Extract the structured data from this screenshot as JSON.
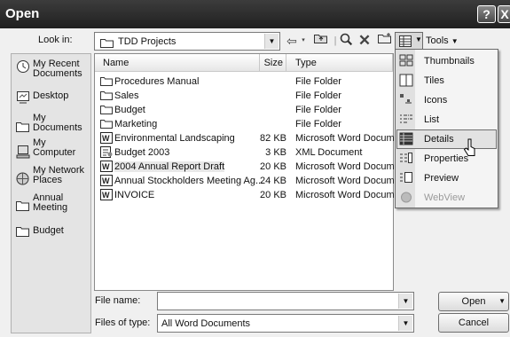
{
  "window": {
    "title": "Open",
    "help_button": "?",
    "close_button": "X"
  },
  "lookin": {
    "label": "Look in:",
    "value": "TDD Projects"
  },
  "toolbar": {
    "tools_label": "Tools"
  },
  "places": [
    {
      "label": "My Recent Documents",
      "icon": "recent-documents-icon"
    },
    {
      "label": "Desktop",
      "icon": "desktop-icon"
    },
    {
      "label": "My Documents",
      "icon": "my-documents-icon"
    },
    {
      "label": "My Computer",
      "icon": "computer-icon"
    },
    {
      "label": "My Network Places",
      "icon": "network-icon"
    },
    {
      "label": "Annual Meeting",
      "icon": "folder-icon"
    },
    {
      "label": "Budget",
      "icon": "folder-icon"
    }
  ],
  "columns": {
    "name": "Name",
    "size": "Size",
    "type": "Type"
  },
  "files": [
    {
      "name": "Procedures Manual",
      "size": "",
      "type": "File Folder",
      "icon": "folder"
    },
    {
      "name": "Sales",
      "size": "",
      "type": "File Folder",
      "icon": "folder"
    },
    {
      "name": "Budget",
      "size": "",
      "type": "File Folder",
      "icon": "folder"
    },
    {
      "name": "Marketing",
      "size": "",
      "type": "File Folder",
      "icon": "folder"
    },
    {
      "name": "Environmental Landscaping",
      "size": "82 KB",
      "type": "Microsoft Word Documen",
      "icon": "word"
    },
    {
      "name": "Budget 2003",
      "size": "3 KB",
      "type": "XML Document",
      "icon": "xml"
    },
    {
      "name": "2004 Annual Report Draft",
      "size": "20 KB",
      "type": "Microsoft Word Documen",
      "icon": "word"
    },
    {
      "name": "Annual Stockholders Meeting Ag...",
      "size": "24 KB",
      "type": "Microsoft Word Documen",
      "icon": "word"
    },
    {
      "name": "INVOICE",
      "size": "20 KB",
      "type": "Microsoft Word Documen",
      "icon": "word"
    }
  ],
  "filename": {
    "label": "File name:",
    "value": ""
  },
  "filetype": {
    "label": "Files of type:",
    "value": "All Word Documents"
  },
  "buttons": {
    "open": "Open",
    "cancel": "Cancel"
  },
  "views_menu": [
    {
      "label": "Thumbnails",
      "icon": "thumbnails-icon",
      "state": "normal"
    },
    {
      "label": "Tiles",
      "icon": "tiles-icon",
      "state": "normal"
    },
    {
      "label": "Icons",
      "icon": "icons-view-icon",
      "state": "normal"
    },
    {
      "label": "List",
      "icon": "list-view-icon",
      "state": "normal"
    },
    {
      "label": "Details",
      "icon": "details-view-icon",
      "state": "highlighted"
    },
    {
      "label": "Properties",
      "icon": "properties-icon",
      "state": "normal"
    },
    {
      "label": "Preview",
      "icon": "preview-icon",
      "state": "normal"
    },
    {
      "label": "WebView",
      "icon": "webview-icon",
      "state": "disabled"
    }
  ]
}
